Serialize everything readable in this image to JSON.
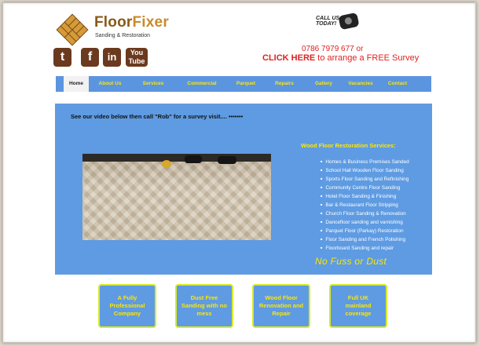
{
  "brand": {
    "name_part1": "Floor",
    "name_part2": "Fixer",
    "tagline": "Sanding & Restoration"
  },
  "social": [
    {
      "icon": "twitter-icon",
      "label": "t"
    },
    {
      "icon": "facebook-icon",
      "label": "f"
    },
    {
      "icon": "linkedin-icon",
      "label": "in"
    },
    {
      "icon": "youtube-icon",
      "label": "You Tube"
    }
  ],
  "contact": {
    "call_us_line1": "CALL US",
    "call_us_line2": "TODAY!",
    "phone": "0786 7979 677 or",
    "cta_link": "CLICK HERE",
    "cta_rest": " to arrange a FREE Survey"
  },
  "nav": {
    "items": [
      "Home",
      "About Us",
      "Services",
      "Commercial",
      "Parquet",
      "Repairs",
      "Gallery",
      "Vacancies",
      "Contact"
    ],
    "active": "Home"
  },
  "main": {
    "intro": "See our video below then call \"Rob\" for a survey visit.... •••••••",
    "services_title": "Wood Floor Restoration Services:",
    "services": [
      "Homes & Business Premises Sanded",
      "School Hall Wooden Floor Sanding",
      "Sports Floor Sanding and Refinishing",
      "Community Centre Floor Sanding",
      "Hotel Floor Sanding & Finishing",
      "Bar & Restaurant Floor Stripping",
      "Church Floor Sanding & Renovation",
      "Dancefloor sanding and varnishing",
      "Parquet Floor (Parkay) Restoration",
      "Floor Sanding and French Polishing",
      "Floorboard Sanding and repair"
    ],
    "slogan": "No Fuss or Dust"
  },
  "features": [
    "A Fully Professional Company",
    "Dust Free Sanding with no mess",
    "Wood Floor Renovation and Repair",
    "Full UK mainland coverage"
  ],
  "colors": {
    "accent_blue": "#5e9be2",
    "nav_text": "#ffe600",
    "cta_red": "#e02020",
    "brand_orange": "#c98a2b",
    "social_brown": "#6b3a1e"
  }
}
